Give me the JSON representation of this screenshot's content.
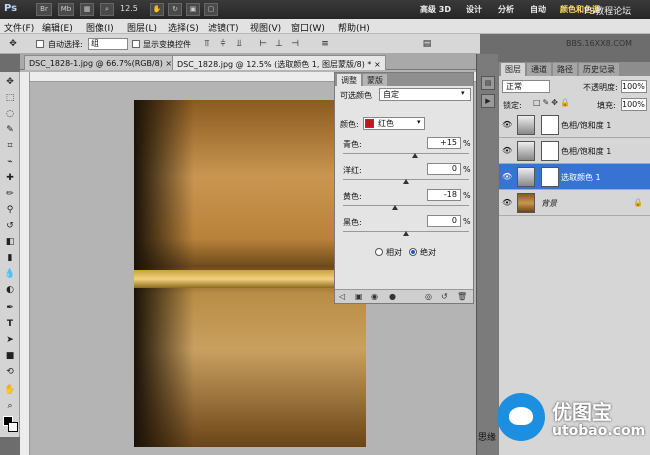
{
  "titlebar": {
    "app_logo": "Ps",
    "zoom": "12.5",
    "workspaces": [
      "高级 3D",
      "设计",
      "分析",
      "自动",
      "颜色和色调"
    ],
    "watermark": "PS教程论坛"
  },
  "menubar": {
    "items": [
      "文件(F)",
      "编辑(E)",
      "图像(I)",
      "图层(L)",
      "选择(S)",
      "滤镜(T)",
      "视图(V)",
      "窗口(W)",
      "帮助(H)"
    ]
  },
  "options": {
    "auto_select_label": "自动选择:",
    "auto_select_value": "组",
    "show_transform_label": "显示变换控件"
  },
  "watermark_url": "BBS.16XX8.COM",
  "doc_tabs": [
    {
      "label": "DSC_1828-1.jpg @ 66.7%(RGB/8)",
      "close": "×"
    },
    {
      "label": "DSC_1828.jpg @ 12.5% (选取颜色 1, 图层蒙版/8) *",
      "close": "×"
    }
  ],
  "adjustments": {
    "tabs": [
      "调整",
      "蒙版"
    ],
    "title": "可选颜色",
    "preset": "自定",
    "colors_label": "颜色:",
    "color_value": "红色",
    "swatch_color": "#c81414",
    "sliders": [
      {
        "label": "青色:",
        "value": "+15",
        "unit": "%",
        "level": 15
      },
      {
        "label": "洋红:",
        "value": "0",
        "unit": "%",
        "level": 0
      },
      {
        "label": "黄色:",
        "value": "-18",
        "unit": "%",
        "level": -18
      },
      {
        "label": "黑色:",
        "value": "0",
        "unit": "%",
        "level": 0
      }
    ],
    "method_relative": "相对",
    "method_absolute": "绝对",
    "method_selected": "absolute"
  },
  "layers_panel": {
    "tabs": [
      "图层",
      "通道",
      "路径",
      "历史记录"
    ],
    "blend_mode": "正常",
    "opacity_label": "不透明度:",
    "opacity_value": "100%",
    "lock_label": "锁定:",
    "fill_label": "填充:",
    "fill_value": "100%",
    "layers": [
      {
        "name": "色相/饱和度 1",
        "type": "adjustment",
        "active": false
      },
      {
        "name": "色相/饱和度 1",
        "type": "adjustment",
        "active": false
      },
      {
        "name": "选取颜色 1",
        "type": "adjustment",
        "active": true
      },
      {
        "name": "背景",
        "type": "background",
        "active": false,
        "locked": true
      }
    ]
  },
  "brand_watermark": {
    "cn": "优图宝",
    "domain": "utobao.com",
    "partial": "思缘"
  }
}
